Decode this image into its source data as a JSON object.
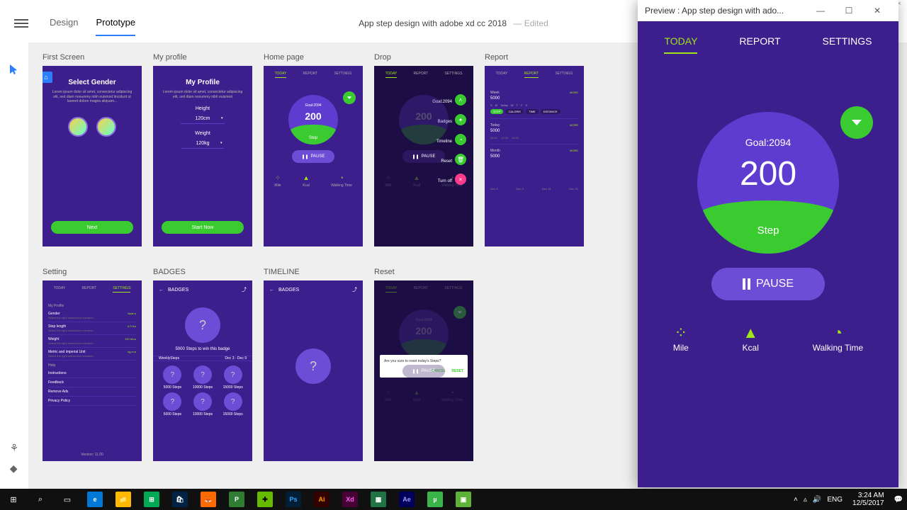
{
  "window": {
    "close": "×"
  },
  "toolbar": {
    "tabs": {
      "design": "Design",
      "prototype": "Prototype"
    },
    "title": "App step design with adobe xd cc 2018",
    "edited": "—  Edited"
  },
  "artboards": {
    "first": {
      "label": "First Screen",
      "title": "Select Gender",
      "sub": "Lorem ipsum dolor sit amet, consectetur adipiscing elit, sed diam nonummy nibh euismod tincidunt ut laoreet dolore magna aliquam...",
      "btn": "Next"
    },
    "profile": {
      "label": "My profile",
      "title": "My Profile",
      "sub": "Lorem ipsum dolor sit amet, consectetur adipiscing elit, sed diam nonummy nibh euismod",
      "height_lbl": "Height",
      "height_val": "120cm",
      "weight_lbl": "Weight",
      "weight_val": "120kg",
      "btn": "Start Now"
    },
    "home": {
      "label": "Home page",
      "tabs": [
        "TODAY",
        "REPORT",
        "SETTINGS"
      ],
      "goal": "Goal:2094",
      "num": "200",
      "step": "Step",
      "pause": "PAUSE",
      "stats": [
        "Mile",
        "Kcal",
        "Walking Time"
      ]
    },
    "drop": {
      "label": "Drop",
      "items": [
        "Goal:2094",
        "Badges",
        "Timeline",
        "Reset",
        "Turn off"
      ]
    },
    "report": {
      "label": "Report",
      "week": "Week",
      "wk_val": "5000",
      "today_l": "Today",
      "tv": "5000",
      "month": "Month",
      "mv": "5000",
      "more": "MORE",
      "days": [
        "S",
        "M",
        "Today",
        "W",
        "T",
        "F",
        "S"
      ],
      "pills": [
        "STEP",
        "CALORIE",
        "TIME",
        "DISTANCE"
      ],
      "times": [
        "06:00",
        "12:00",
        "00:00"
      ],
      "axis": [
        "Dec 3",
        "Dec 9",
        "Dec 15",
        "Dec 21"
      ]
    },
    "setting": {
      "label": "Setting",
      "tabs": [
        "TODAY",
        "REPORT",
        "SETTINGS"
      ],
      "cat1": "My Profile",
      "rows": [
        [
          "Gender",
          "Male ▸"
        ],
        [
          "Step length",
          "0.9 ft ▸"
        ],
        [
          "Weight",
          "120 lbs ▸"
        ],
        [
          "Metric and imperial Unit",
          "kg,m ▸"
        ]
      ],
      "sub": "Select the right subsection research",
      "cat2": "Help",
      "help": [
        "Instructions",
        "Feedback",
        "Remove Ads",
        "Privacy Policy"
      ],
      "ver": "Version: 11.00"
    },
    "badges": {
      "label": "BADGES",
      "hdr": "BADGES",
      "q": "?",
      "txt": "5000 Steps to win this badge",
      "gh_l": "WeeklySteps",
      "gh_r": "Dec 3 - Dec 9",
      "cells": [
        "5000 Steps",
        "10000 Steps",
        "15000 Steps",
        "5000 Steps",
        "10000 Steps",
        "15000 Steps"
      ]
    },
    "timeline": {
      "label": "TIMELINE",
      "hdr": "BADGES",
      "q": "?"
    },
    "reset": {
      "label": "Reset",
      "msg": "Are you sure to reset today's Steps?",
      "cancel": "CANCEL",
      "ok": "RESET"
    }
  },
  "preview": {
    "title": "Preview : App step design with ado...",
    "tabs": {
      "today": "TODAY",
      "report": "REPORT",
      "settings": "SETTINGS"
    },
    "goal": "Goal:2094",
    "num": "200",
    "step": "Step",
    "pause": "PAUSE",
    "stats": {
      "mile": "Mile",
      "kcal": "Kcal",
      "walking": "Walking Time"
    }
  },
  "taskbar": {
    "apps": [
      {
        "bg": "#0078d7",
        "fg": "#fff",
        "t": "e"
      },
      {
        "bg": "#ffb900",
        "fg": "#000",
        "t": "📁"
      },
      {
        "bg": "#0a5",
        "fg": "#fff",
        "t": "⊞"
      },
      {
        "bg": "#024",
        "fg": "#fff",
        "t": "🛍"
      },
      {
        "bg": "#ff6a00",
        "fg": "#fff",
        "t": "🦊"
      },
      {
        "bg": "#2e7d32",
        "fg": "#fff",
        "t": "P"
      },
      {
        "bg": "#6b0",
        "fg": "#000",
        "t": "✚"
      },
      {
        "bg": "#001e36",
        "fg": "#31a8ff",
        "t": "Ps"
      },
      {
        "bg": "#330000",
        "fg": "#ff9a00",
        "t": "Ai"
      },
      {
        "bg": "#470137",
        "fg": "#ff61f6",
        "t": "Xd"
      },
      {
        "bg": "#217346",
        "fg": "#fff",
        "t": "▦"
      },
      {
        "bg": "#00005b",
        "fg": "#9999ff",
        "t": "Ae"
      },
      {
        "bg": "#39b54a",
        "fg": "#fff",
        "t": "µ"
      },
      {
        "bg": "#5fb238",
        "fg": "#fff",
        "t": "▣"
      }
    ],
    "lang": "ENG",
    "time": "3:24 AM",
    "date": "12/5/2017"
  }
}
